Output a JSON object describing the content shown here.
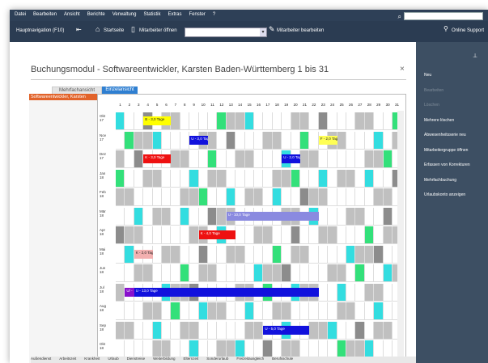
{
  "menu": {
    "items": [
      "Datei",
      "Bearbeiten",
      "Ansicht",
      "Berichte",
      "Verwaltung",
      "Statistik",
      "Extras",
      "Fenster",
      "?"
    ]
  },
  "toolbar": {
    "nav_label": "Hauptnavigation (F10)",
    "start_label": "Startseite",
    "open_label": "Mitarbeiter öffnen",
    "edit_label": "Mitarbeiter bearbeiten",
    "support_label": "Online Support"
  },
  "module": {
    "title": "Buchungsmodul - Softwareentwickler, Karsten  Baden-Württemberg   1 bis 31",
    "tab_multi": "Mehrfachansicht",
    "tab_single": "Einzelansicht",
    "employee": "Softwareentwickler, Karsten"
  },
  "calendar": {
    "days": [
      "1",
      "2",
      "3",
      "4",
      "5",
      "6",
      "7",
      "8",
      "9",
      "10",
      "11",
      "12",
      "13",
      "14",
      "15",
      "16",
      "17",
      "18",
      "19",
      "20",
      "21",
      "22",
      "23",
      "24",
      "25",
      "26",
      "27",
      "28",
      "29",
      "30",
      "31"
    ],
    "months": [
      "Okt 17",
      "Nov 17",
      "Dez 17",
      "Jan 18",
      "Feb 18",
      "Mär 18",
      "Apr 18",
      "Mai 18",
      "Jun 18",
      "Jul 18",
      "Aug 18",
      "Sep 18",
      "Okt 18"
    ],
    "colors": {
      "weekend": "#c0c0c0",
      "empty": "#ffffff",
      "cyan": "#33dde0",
      "green": "#33e07a",
      "grey": "#8c8c8c"
    },
    "events": [
      {
        "label": "B - 3,0 Tage",
        "month": 0,
        "start": 4,
        "len": 3,
        "color": "#ffff00",
        "text": "#222"
      },
      {
        "label": "U - 3,0 Tage",
        "month": 1,
        "start": 9,
        "len": 2,
        "color": "#1111dd",
        "text": "#fff"
      },
      {
        "label": "F - 2,0 Tage",
        "month": 1,
        "start": 23,
        "len": 2,
        "color": "#ffff55",
        "text": "#222"
      },
      {
        "label": "K - 3,0 Tage",
        "month": 2,
        "start": 4,
        "len": 3,
        "color": "#ee1111",
        "text": "#fff"
      },
      {
        "label": "U - 2,0 Tage",
        "month": 2,
        "start": 19,
        "len": 2,
        "color": "#1111dd",
        "text": "#fff"
      },
      {
        "label": "U - 10,0 Tage",
        "month": 5,
        "start": 13,
        "len": 10,
        "color": "#8a8ae0",
        "text": "#fff"
      },
      {
        "label": "K - 4,0 Tage",
        "month": 6,
        "start": 10,
        "len": 4,
        "color": "#ee1111",
        "text": "#fff"
      },
      {
        "label": "K - 2,0 Tage",
        "month": 7,
        "start": 3,
        "len": 2,
        "color": "#f3b0b0",
        "text": "#222"
      },
      {
        "label": "U/ -",
        "month": 9,
        "start": 2,
        "len": 1,
        "color": "#8811cc",
        "text": "#fff"
      },
      {
        "label": "U - 13,0 Tage",
        "month": 9,
        "start": 3,
        "len": 20,
        "color": "#1111dd",
        "text": "#fff"
      },
      {
        "label": "U - 5,0 Tage",
        "month": 11,
        "start": 17,
        "len": 5,
        "color": "#1111dd",
        "text": "#fff"
      }
    ]
  },
  "sidebar": {
    "items": [
      {
        "label": "Neu",
        "enabled": true
      },
      {
        "label": "Bearbeiten",
        "enabled": false
      },
      {
        "label": "Löschen",
        "enabled": false
      },
      {
        "label": "Mehrere löschen",
        "enabled": true
      },
      {
        "label": "Abwesenheitsserie neu",
        "enabled": true
      },
      {
        "label": "Mitarbeitergruppe öffnen",
        "enabled": true
      },
      {
        "label": "Erfassen von Korrekturen",
        "enabled": true
      },
      {
        "label": "Mehrfachbuchung",
        "enabled": true
      },
      {
        "label": "Urlaubskonto anzeigen",
        "enabled": true
      }
    ]
  },
  "statusbar": {
    "items": [
      "Außendienst",
      "Arbeitszeit",
      "Krankheit",
      "Urlaub",
      "Dienstreise",
      "Weiterbildung",
      "Elternzeit",
      "Sonderurlaub",
      "Freizeitausgleich",
      "Berufsschule"
    ]
  }
}
